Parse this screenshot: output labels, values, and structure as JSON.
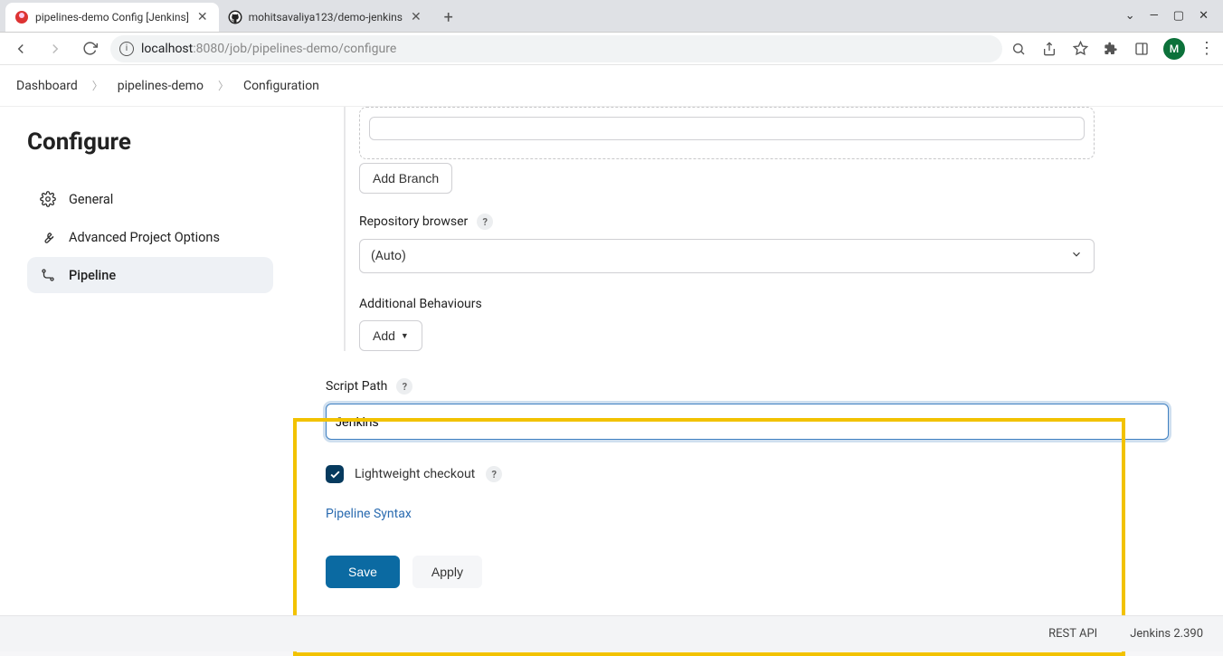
{
  "browser": {
    "tabs": [
      {
        "title": "pipelines-demo Config [Jenkins]"
      },
      {
        "title": "mohitsavaliya123/demo-jenkins"
      }
    ],
    "url_host": "localhost",
    "url_port": ":8080",
    "url_path": "/job/pipelines-demo/configure",
    "profile_initial": "M"
  },
  "breadcrumbs": [
    "Dashboard",
    "pipelines-demo",
    "Configuration"
  ],
  "sidebar": {
    "title": "Configure",
    "items": [
      {
        "label": "General"
      },
      {
        "label": "Advanced Project Options"
      },
      {
        "label": "Pipeline"
      }
    ]
  },
  "form": {
    "add_branch": "Add Branch",
    "repo_browser_label": "Repository browser",
    "repo_browser_value": "(Auto)",
    "additional_behaviours_label": "Additional Behaviours",
    "add_label": "Add",
    "script_path_label": "Script Path",
    "script_path_value": "Jenkins",
    "lightweight_label": "Lightweight checkout",
    "lightweight_checked": true,
    "pipeline_syntax": "Pipeline Syntax",
    "save": "Save",
    "apply": "Apply"
  },
  "footer": {
    "rest_api": "REST API",
    "version": "Jenkins 2.390"
  }
}
